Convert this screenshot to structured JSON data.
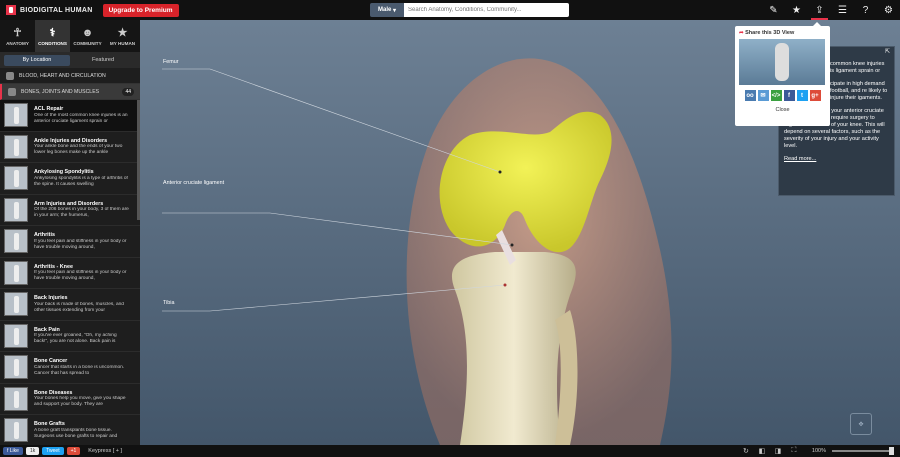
{
  "app": {
    "title": "BIODIGITAL HUMAN",
    "upgrade_label": "Upgrade to Premium"
  },
  "search": {
    "gender": "Male",
    "placeholder": "Search Anatomy, Conditions, Community..."
  },
  "top_icons": [
    "pencil-icon",
    "star-icon",
    "share-icon",
    "checklist-icon",
    "help-icon",
    "gear-icon"
  ],
  "nav": {
    "tabs": [
      "ANATOMY",
      "CONDITIONS",
      "COMMUNITY",
      "MY HUMAN"
    ]
  },
  "subtabs": [
    "By Location",
    "Featured"
  ],
  "categories": [
    {
      "label": "BLOOD, HEART AND CIRCULATION"
    },
    {
      "label": "BONES, JOINTS AND MUSCLES",
      "badge": "44"
    }
  ],
  "items": [
    {
      "title": "ACL Repair",
      "desc": "One of the most common knee injuries is an anterior cruciate ligament sprain or"
    },
    {
      "title": "Ankle Injuries and Disorders",
      "desc": "Your ankle bone and the ends of your two lower leg bones make up the ankle"
    },
    {
      "title": "Ankylosing Spondylitis",
      "desc": "Ankylosing spondylitis is a type of arthritis of the spine. It causes swelling"
    },
    {
      "title": "Arm Injuries and Disorders",
      "desc": "Of the 206 bones in your body, 3 of them are in your arm; the humerus,"
    },
    {
      "title": "Arthritis",
      "desc": "If you feel pain and stiffness in your body or have trouble moving around,"
    },
    {
      "title": "Arthritis - Knee",
      "desc": "If you feel pain and stiffness in your body or have trouble moving around,"
    },
    {
      "title": "Back Injuries",
      "desc": "Your back is made of bones, muscles, and other tissues extending from your"
    },
    {
      "title": "Back Pain",
      "desc": "If you've ever groaned, \"Oh, my aching back!\", you are not alone. Back pain is"
    },
    {
      "title": "Bone Cancer",
      "desc": "Cancer that starts in a bone is uncommon. Cancer that has spread to"
    },
    {
      "title": "Bone Diseases",
      "desc": "Your bones help you move, give you shape and support your body. They are"
    },
    {
      "title": "Bone Grafts",
      "desc": "A bone graft transplants bone tissue. Surgeons use bone grafts to repair and"
    }
  ],
  "labels": {
    "femur": "Femur",
    "acl": "Anterior cruciate ligament",
    "tibia": "Tibia"
  },
  "info": {
    "p1": "common knee injuries is ligament sprain or",
    "p2": "cipate in high demand football, and re likely to injure their igaments.",
    "p3": "If you have injured your anterior cruciate ligament, you may require surgery to regain full function of your knee. This will depend on several factors, such as the severity of your injury and your activity level.",
    "more": "Read more..."
  },
  "share": {
    "title": "Share this 3D View",
    "close": "Close",
    "buttons": [
      "oo",
      "✉",
      "</>",
      "f",
      "t",
      "g+"
    ]
  },
  "bottom": {
    "like": "Like",
    "like_count": "1k",
    "tweet": "Tweet",
    "gplus": "+1",
    "keypress": "Keypress [ + ]",
    "zoom": "100%"
  },
  "colors": {
    "accent": "#e8334a",
    "femur": "#e6e63a"
  }
}
